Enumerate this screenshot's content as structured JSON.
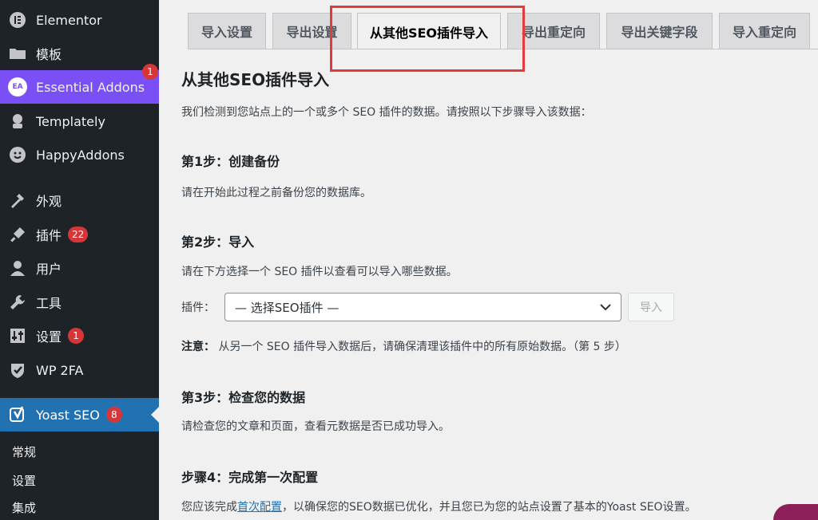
{
  "sidebar": {
    "items": [
      {
        "label": "Elementor",
        "icon": "elementor-icon"
      },
      {
        "label": "模板",
        "icon": "folder-icon"
      },
      {
        "label": "Essential Addons",
        "icon": "essential-addons-icon",
        "badge": "1"
      },
      {
        "label": "Templately",
        "icon": "templately-icon"
      },
      {
        "label": "HappyAddons",
        "icon": "happyaddons-icon"
      },
      {
        "label": "外观",
        "icon": "appearance-icon"
      },
      {
        "label": "插件",
        "icon": "plugins-icon",
        "badge": "22"
      },
      {
        "label": "用户",
        "icon": "user-icon"
      },
      {
        "label": "工具",
        "icon": "wrench-icon"
      },
      {
        "label": "设置",
        "icon": "settings-icon",
        "badge": "1"
      },
      {
        "label": "WP 2FA",
        "icon": "wp2fa-icon"
      },
      {
        "label": "Yoast SEO",
        "icon": "yoast-icon",
        "badge": "8"
      }
    ],
    "subitems": [
      "常规",
      "设置",
      "集成"
    ],
    "ea_icon_text": "EA"
  },
  "tabs": [
    "导入设置",
    "导出设置",
    "从其他SEO插件导入",
    "导出重定向",
    "导出关键字段",
    "导入重定向"
  ],
  "active_tab": "从其他SEO插件导入",
  "content": {
    "title": "从其他SEO插件导入",
    "intro": "我们检测到您站点上的一个或多个 SEO 插件的数据。请按照以下步骤导入该数据：",
    "step1_title": "第1步：创建备份",
    "step1_text": "请在开始此过程之前备份您的数据库。",
    "step2_title": "第2步：导入",
    "step2_text": "请在下方选择一个 SEO 插件以查看可以导入哪些数据。",
    "plugin_label": "插件：",
    "select_value": "— 选择SEO插件 —",
    "import_button": "导入",
    "notice_label": "注意：",
    "notice_text": "从另一个 SEO 插件导入数据后，请确保清理该插件中的所有原始数据。（第 5 步）",
    "step3_title": "第3步：检查您的数据",
    "step3_text": "请检查您的文章和页面，查看元数据是否已成功导入。",
    "step4_title": "步骤4：完成第一次配置",
    "step4_text_before": "您应该完成",
    "step4_link": "首次配置",
    "step4_text_after": "，以确保您的SEO数据已优化，并且您已为您的站点设置了基本的Yoast SEO设置。"
  },
  "colors": {
    "sidebar_bg": "#1d2327",
    "essential_addons_bg": "#7b4ff6",
    "yoast_active_bg": "#2271b1",
    "badge": "#d63638",
    "highlight_box": "#e23b3b",
    "link": "#2271b1"
  }
}
